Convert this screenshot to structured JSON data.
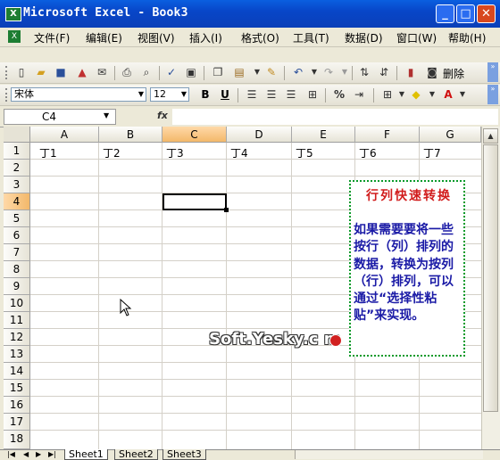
{
  "window": {
    "title": "Microsoft Excel - Book3",
    "minimize": "_",
    "maximize": "□",
    "close": "✕"
  },
  "app_icon_glyph": "X",
  "menu": [
    {
      "label": "文件(F)"
    },
    {
      "label": "编辑(E)"
    },
    {
      "label": "视图(V)"
    },
    {
      "label": "插入(I)"
    },
    {
      "label": "格式(O)"
    },
    {
      "label": "工具(T)"
    },
    {
      "label": "数据(D)"
    },
    {
      "label": "窗口(W)"
    },
    {
      "label": "帮助(H)"
    }
  ],
  "toolbar": {
    "delete_label": "删除"
  },
  "format": {
    "font": "宋体",
    "size": "12",
    "bold": "B",
    "underline": "U",
    "percent": "%"
  },
  "formula": {
    "name_box": "C4",
    "fx": "fx",
    "value": ""
  },
  "columns": [
    "A",
    "B",
    "C",
    "D",
    "E",
    "F",
    "G"
  ],
  "active_column": "C",
  "rows": [
    "1",
    "2",
    "3",
    "4",
    "5",
    "6",
    "7",
    "8",
    "9",
    "10",
    "11",
    "12",
    "13",
    "14",
    "15",
    "16",
    "17",
    "18"
  ],
  "active_row": "4",
  "row1_cells": [
    "丁1",
    "丁2",
    "丁3",
    "丁4",
    "丁5",
    "丁6",
    "丁7"
  ],
  "note": {
    "title": "行列快速转换",
    "body": "如果需要要将一些按行（列）排列的数据，转换为按列（行）排列，可以通过“选择性粘贴”来实现。"
  },
  "watermark": "Soft.Yesky.c  m",
  "sheets": [
    "Sheet1",
    "Sheet2",
    "Sheet3"
  ],
  "colors": {
    "title_bar": "#0a4fd0",
    "note_border": "#0a9a2a",
    "note_title": "#d11c1c",
    "note_text": "#1a1aa6",
    "active_header": "#f3b86a"
  },
  "icons": [
    "excel-app-icon",
    "new-icon",
    "open-icon",
    "save-icon",
    "permission-icon",
    "email-icon",
    "print-icon",
    "print-preview-icon",
    "spelling-icon",
    "research-icon",
    "copy-icon",
    "paste-icon",
    "format-painter-icon",
    "undo-icon",
    "redo-icon",
    "sort-ascending-icon",
    "sort-descending-icon",
    "chart-icon",
    "camera-icon",
    "bold-icon",
    "underline-icon",
    "align-left-icon",
    "align-center-icon",
    "align-right-icon",
    "merge-center-icon",
    "percent-icon",
    "borders-icon",
    "fill-color-icon",
    "font-color-icon",
    "fx-icon",
    "mouse-pointer-icon"
  ]
}
